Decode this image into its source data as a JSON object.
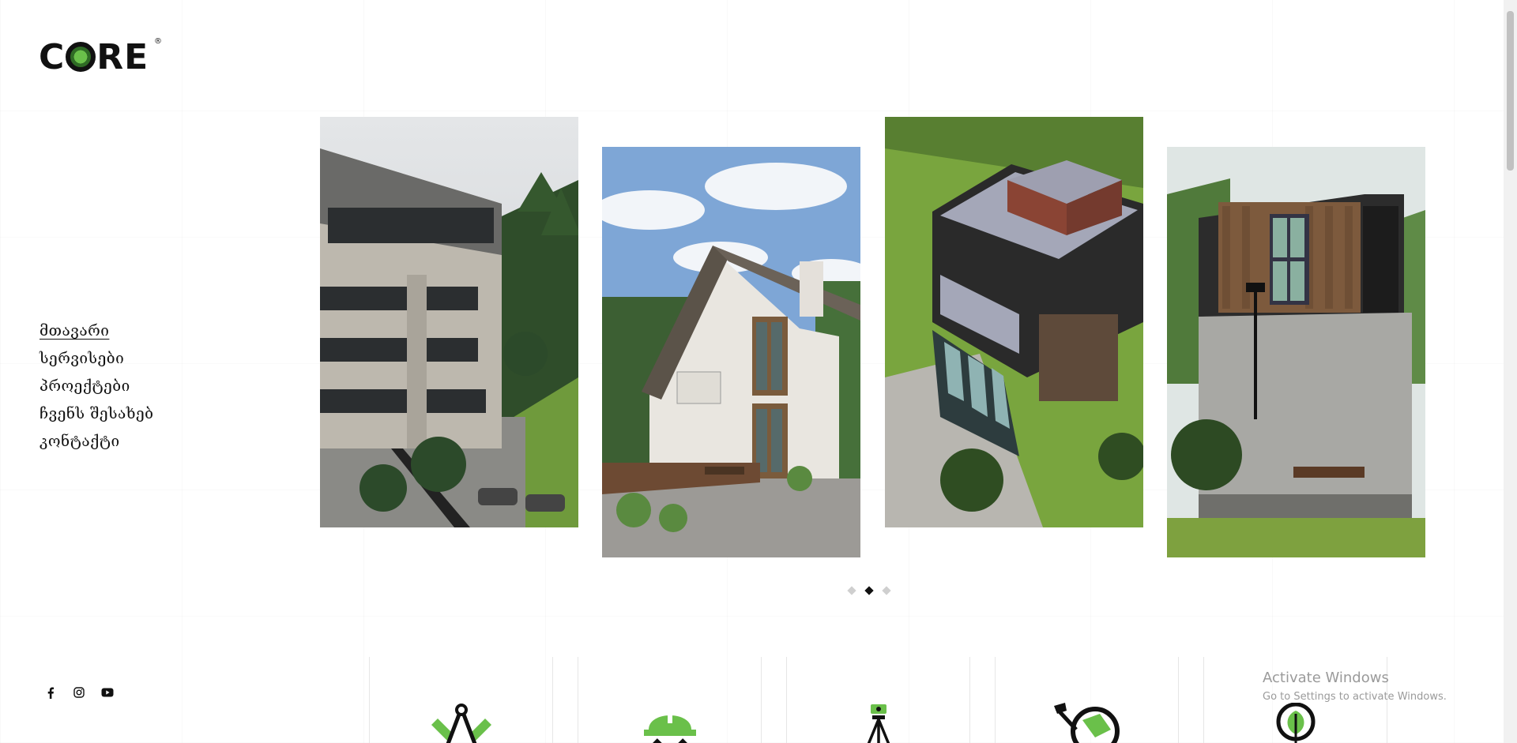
{
  "brand": {
    "logo_text_before": "C",
    "logo_text_after": "RE",
    "registered": "®"
  },
  "nav": {
    "items": [
      {
        "label": "მთავარი",
        "active": true
      },
      {
        "label": "სერვისები",
        "active": false
      },
      {
        "label": "პროექტები",
        "active": false
      },
      {
        "label": "ჩვენს შესახებ",
        "active": false
      },
      {
        "label": "კონტაქტი",
        "active": false
      }
    ]
  },
  "socials": [
    {
      "icon": "facebook-icon"
    },
    {
      "icon": "instagram-icon"
    },
    {
      "icon": "youtube-icon"
    }
  ],
  "carousel": {
    "slides": [
      {
        "subject": "multi-storey concrete building on hillside"
      },
      {
        "subject": "white gabled house with wooden windows"
      },
      {
        "subject": "aerial view of modern flat-roof house"
      },
      {
        "subject": "concrete cube house with wood cladding"
      }
    ],
    "dots": 3,
    "active_dot": 1
  },
  "services": [
    {
      "icon": "compass-ruler-icon"
    },
    {
      "icon": "hard-hat-gear-icon"
    },
    {
      "icon": "survey-tripod-icon"
    },
    {
      "icon": "globe-hammer-icon"
    },
    {
      "icon": "lightbulb-leaf-icon"
    }
  ],
  "system_overlay": {
    "title": "Activate Windows",
    "subtitle": "Go to Settings to activate Windows."
  },
  "colors": {
    "accent_green": "#6ac04a",
    "text": "#111111"
  }
}
